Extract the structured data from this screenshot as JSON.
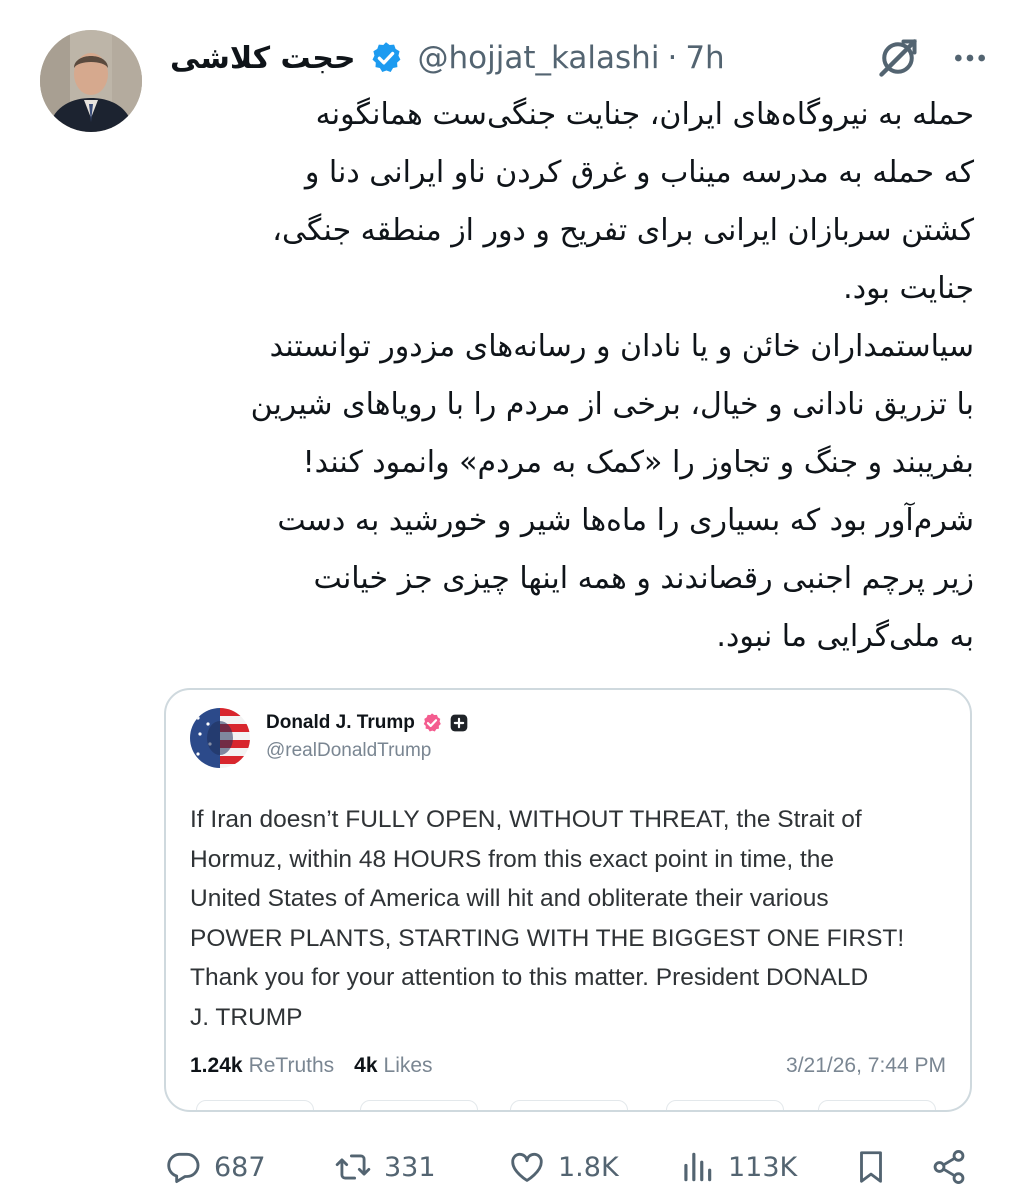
{
  "author": {
    "display_name": "حجت کلاشی",
    "handle": "@hojjat_kalashi",
    "separator": "·",
    "time": "7h"
  },
  "body_lines": [
    "حمله به نیروگاه‌های ایران، جنایت جنگی‌ست همانگونه",
    "که حمله به مدرسه میناب و غرق کردن ناو ایرانی دنا و",
    "کشتن سربازان ایرانی برای تفریح و دور از منطقه جنگی،",
    "جنایت بود.",
    "سیاستمداران خائن و یا نادان و رسانه‌های مزدور توانستند",
    "با تزریق نادانی و خیال، برخی از مردم را با رویاهای شیرین",
    "بفریبند و جنگ و تجاوز را «کمک به مردم» وانمود کنند!",
    "شرم‌آور بود که بسیاری را ماه‌ها شیر و خورشید به دست",
    "زیر پرچم اجنبی رقصاندند و همه اینها چیزی جز خیانت",
    "به ملی‌گرایی ما نبود."
  ],
  "quoted": {
    "name": "Donald J. Trump",
    "handle": "@realDonaldTrump",
    "text_lines": [
      "If Iran doesn’t FULLY OPEN, WITHOUT THREAT, the Strait of",
      "Hormuz, within 48 HOURS from this exact point in time, the",
      "United States of America will hit and obliterate their various",
      "POWER PLANTS, STARTING WITH THE BIGGEST ONE FIRST!",
      "Thank you for your attention to this matter. President DONALD",
      "J. TRUMP"
    ],
    "retruths_count": "1.24k",
    "retruths_label": "ReTruths",
    "likes_count": "4k",
    "likes_label": "Likes",
    "date": "3/21/26, 7:44 PM"
  },
  "actions": {
    "replies": "687",
    "reposts": "331",
    "likes": "1.8K",
    "views": "113K"
  },
  "colors": {
    "verified_blue": "#1d9bf0",
    "truth_badge": "#f45c8f",
    "muted_text": "#536471",
    "card_border": "#cfd9de"
  },
  "icons": [
    "verified-badge-icon",
    "grok-icon",
    "more-icon",
    "reply-icon",
    "repost-icon",
    "like-icon",
    "views-icon",
    "bookmark-icon",
    "share-icon"
  ]
}
